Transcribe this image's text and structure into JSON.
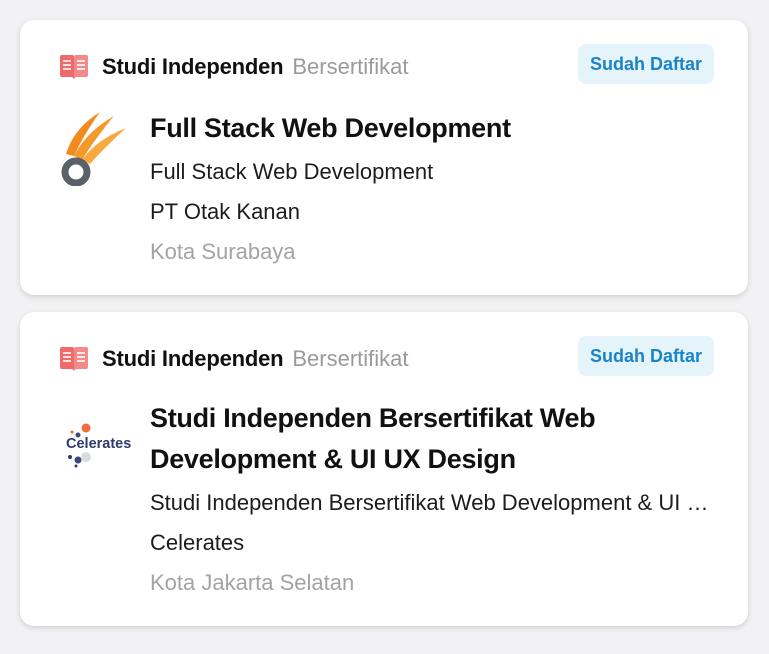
{
  "cards": [
    {
      "program_type": "Studi Independen",
      "program_sub": "Bersertifikat",
      "status": "Sudah Daftar",
      "title": "Full Stack Web Development",
      "subtitle": "Full Stack Web Development",
      "company": "PT Otak Kanan",
      "location": "Kota Surabaya",
      "logo_icon": "otak-kanan-logo"
    },
    {
      "program_type": "Studi Independen",
      "program_sub": "Bersertifikat",
      "status": "Sudah Daftar",
      "title": "Studi Independen Bersertifikat Web Development & UI UX Design",
      "subtitle": "Studi Independen Bersertifikat Web Development & UI UX Design",
      "company": "Celerates",
      "location": "Kota Jakarta Selatan",
      "logo_icon": "celerates-logo",
      "logo_text": "Celerates"
    }
  ],
  "colors": {
    "badge_bg": "#e5f3fa",
    "badge_text": "#1a84c7",
    "book_icon": "#f06a6a",
    "muted_text": "#9a9a9a",
    "otak_kanan_orange": "#f28b1e",
    "otak_kanan_gray": "#5b6168",
    "celerates_navy": "#2d3a6e",
    "celerates_orange": "#f26b3a"
  }
}
